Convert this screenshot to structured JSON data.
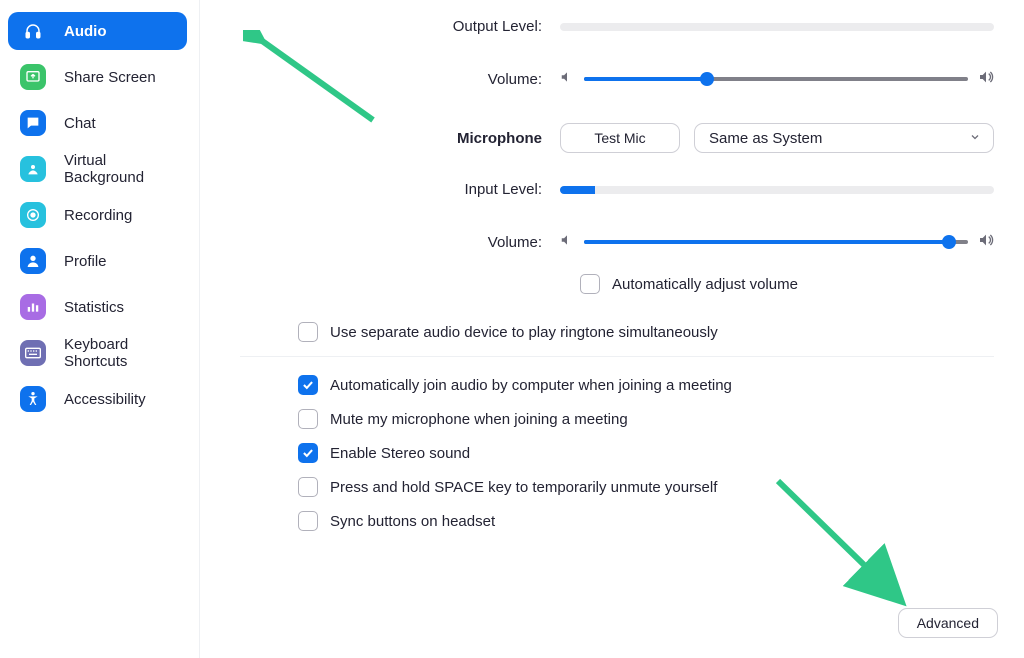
{
  "sidebar": {
    "items": [
      {
        "label": "Audio",
        "iconBg": "#0e72ed",
        "iconName": "headphones-icon",
        "active": true
      },
      {
        "label": "Share Screen",
        "iconBg": "#3bc46a",
        "iconName": "share-screen-icon",
        "active": false
      },
      {
        "label": "Chat",
        "iconBg": "#0e72ed",
        "iconName": "chat-icon",
        "active": false
      },
      {
        "label": "Virtual Background",
        "iconBg": "#27c1de",
        "iconName": "virtual-bg-icon",
        "active": false
      },
      {
        "label": "Recording",
        "iconBg": "#27c1de",
        "iconName": "recording-icon",
        "active": false
      },
      {
        "label": "Profile",
        "iconBg": "#0e72ed",
        "iconName": "profile-icon",
        "active": false
      },
      {
        "label": "Statistics",
        "iconBg": "#a86ce4",
        "iconName": "statistics-icon",
        "active": false
      },
      {
        "label": "Keyboard Shortcuts",
        "iconBg": "#6f6fb3",
        "iconName": "keyboard-icon",
        "active": false
      },
      {
        "label": "Accessibility",
        "iconBg": "#0e72ed",
        "iconName": "accessibility-icon",
        "active": false
      }
    ]
  },
  "output": {
    "level_label": "Output Level:",
    "level_pct": 0,
    "volume_label": "Volume:",
    "volume_pct": 32
  },
  "microphone": {
    "section_label": "Microphone",
    "test_label": "Test Mic",
    "device_selected": "Same as System",
    "input_level_label": "Input Level:",
    "input_level_pct": 8,
    "volume_label": "Volume:",
    "volume_pct": 95,
    "auto_adjust_label": "Automatically adjust volume",
    "auto_adjust_checked": false
  },
  "options": {
    "separate_ringtone": {
      "label": "Use separate audio device to play ringtone simultaneously",
      "checked": false
    },
    "auto_join_audio": {
      "label": "Automatically join audio by computer when joining a meeting",
      "checked": true
    },
    "mute_on_join": {
      "label": "Mute my microphone when joining a meeting",
      "checked": false
    },
    "enable_stereo": {
      "label": "Enable Stereo sound",
      "checked": true
    },
    "space_unmute": {
      "label": "Press and hold SPACE key to temporarily unmute yourself",
      "checked": false
    },
    "sync_headset": {
      "label": "Sync buttons on headset",
      "checked": false
    }
  },
  "advanced_label": "Advanced"
}
